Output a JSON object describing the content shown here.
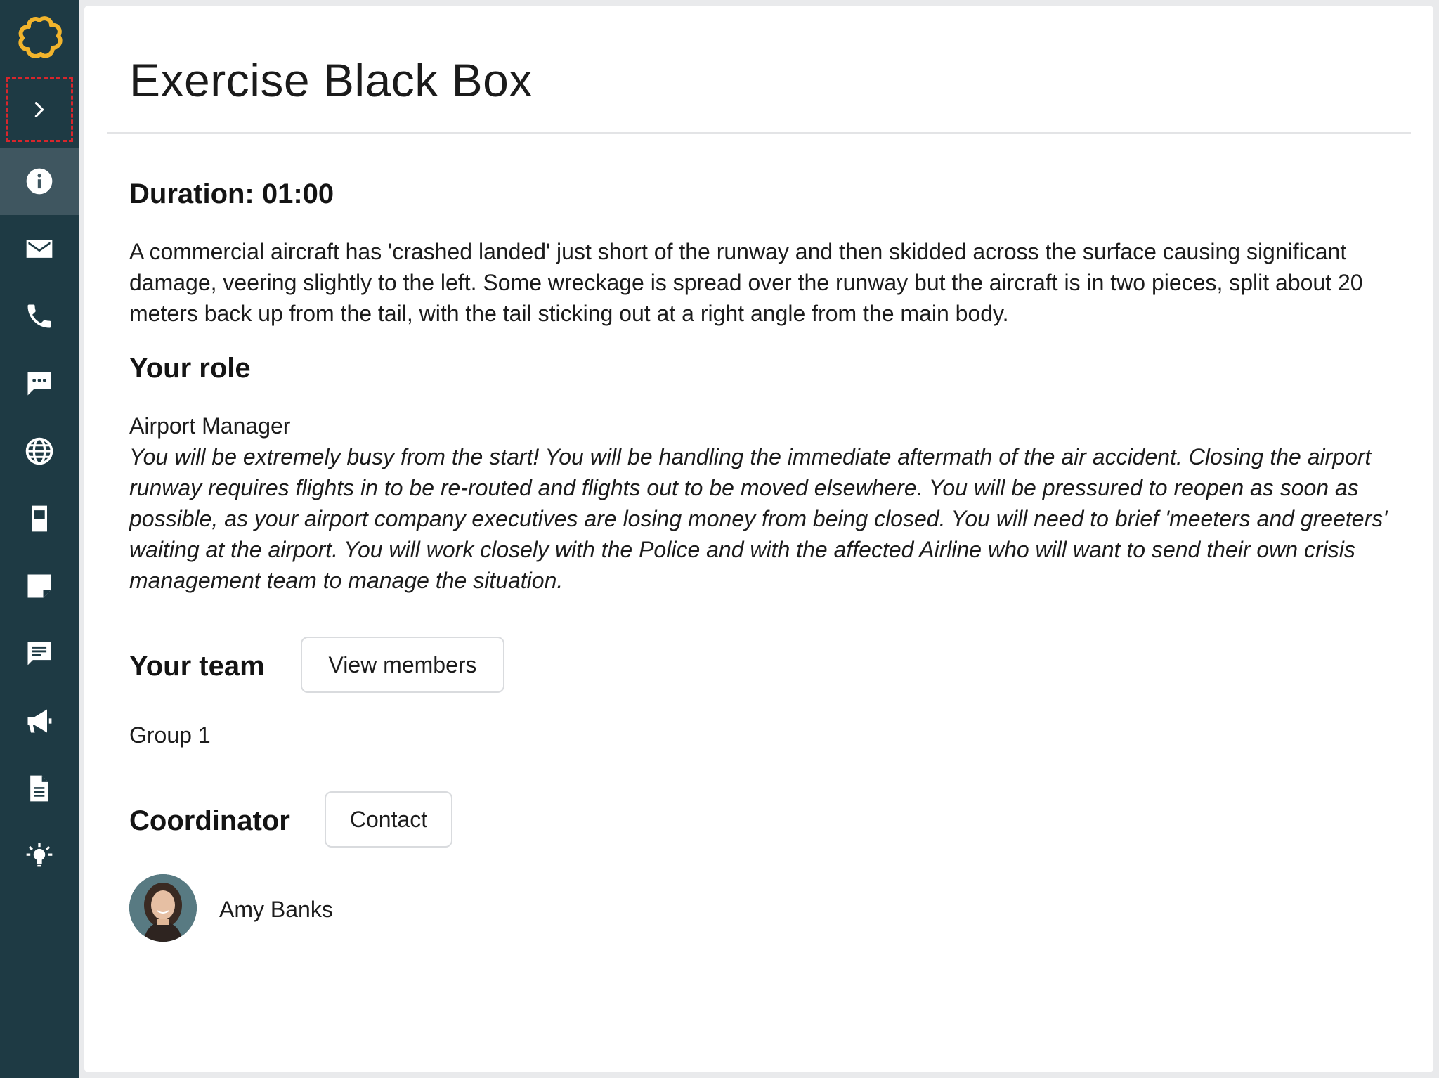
{
  "app": {
    "title": "Exercise Black Box"
  },
  "sidebar": {
    "logo_icon": "flower-logo-icon",
    "expand_icon": "chevron-right-icon",
    "items": [
      {
        "icon": "info-icon",
        "active": true
      },
      {
        "icon": "mail-icon",
        "active": false
      },
      {
        "icon": "phone-icon",
        "active": false
      },
      {
        "icon": "chat-bubble-dots-icon",
        "active": false
      },
      {
        "icon": "globe-icon",
        "active": false
      },
      {
        "icon": "mobile-device-icon",
        "active": false
      },
      {
        "icon": "note-icon",
        "active": false
      },
      {
        "icon": "message-lines-icon",
        "active": false
      },
      {
        "icon": "megaphone-icon",
        "active": false
      },
      {
        "icon": "document-icon",
        "active": false
      },
      {
        "icon": "lightbulb-icon",
        "active": false
      }
    ]
  },
  "duration": {
    "label": "Duration: 01:00"
  },
  "scenario": {
    "text": "A commercial aircraft has 'crashed landed' just short of the runway and then skidded across the surface causing significant damage, veering slightly to the left. Some wreckage is spread over the runway but the aircraft is in two pieces, split about 20 meters back up from the tail, with the tail sticking out at a right angle from the main body."
  },
  "role": {
    "heading": "Your role",
    "name": "Airport Manager",
    "description": "You will be extremely busy from the start! You will be handling the immediate aftermath of the air accident. Closing the airport runway requires flights in to be re-routed and flights out to be moved elsewhere. You will be pressured to reopen as soon as possible, as your airport company executives are losing money from being closed. You will need to brief 'meeters and greeters' waiting at the airport. You will work closely with the Police and with the affected Airline who will want to send their own crisis management team to manage the situation."
  },
  "team": {
    "heading": "Your team",
    "button_label": "View members",
    "group": "Group 1"
  },
  "coordinator": {
    "heading": "Coordinator",
    "button_label": "Contact",
    "name": "Amy Banks"
  },
  "colors": {
    "sidebar_bg": "#1e3a44",
    "sidebar_active": "#3f5660",
    "logo": "#f2b42c",
    "focus_outline": "#d8262c"
  }
}
